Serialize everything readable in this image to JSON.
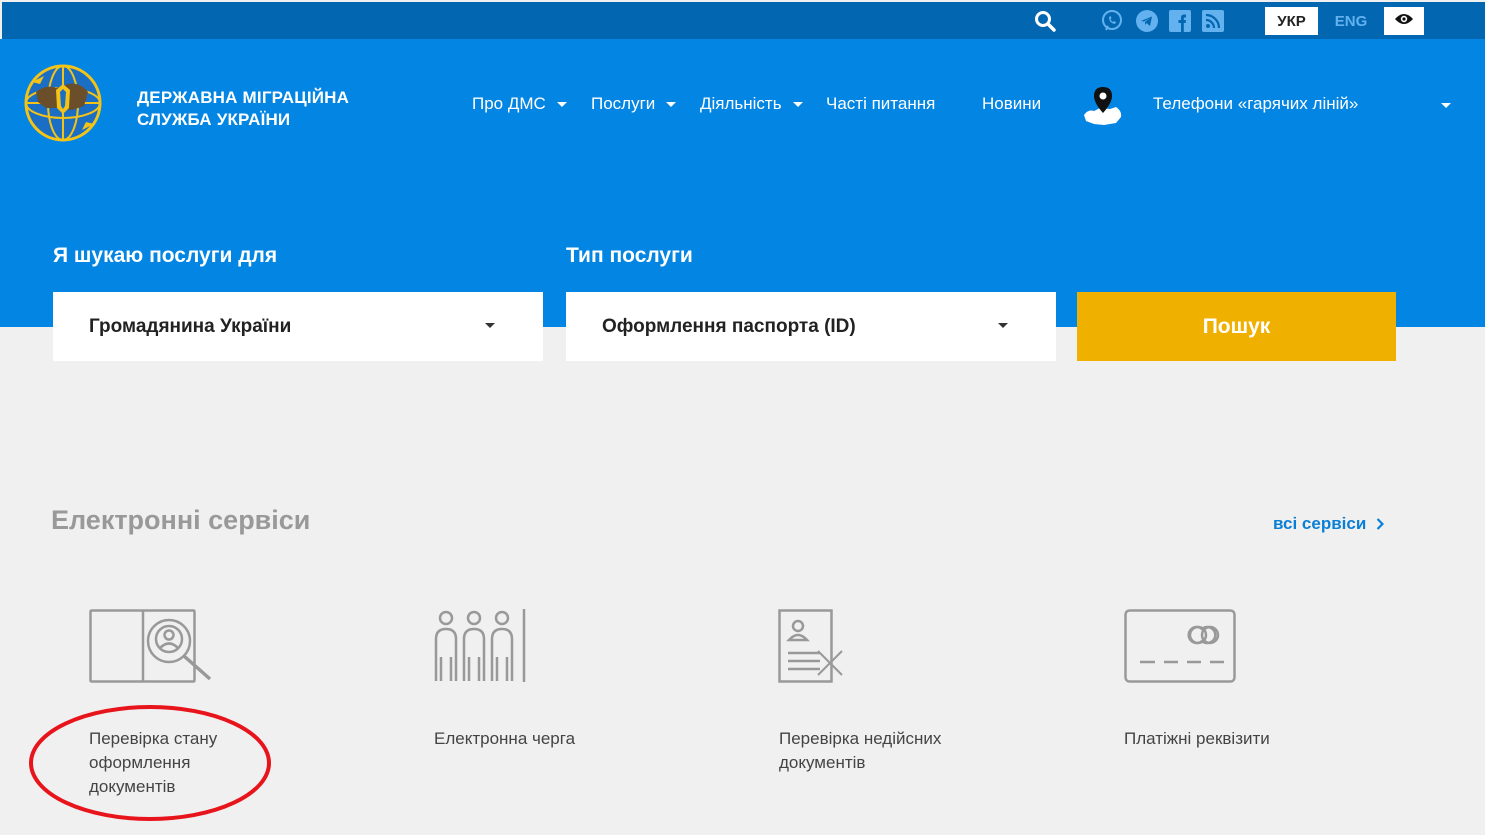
{
  "topbar": {
    "icons": [
      "search-icon",
      "viber-icon",
      "telegram-icon",
      "facebook-icon",
      "rss-icon",
      "eye-icon"
    ],
    "lang_ukr": "УКР",
    "lang_eng": "ENG"
  },
  "header": {
    "org_line1": "ДЕРЖАВНА МІГРАЦІЙНА",
    "org_line2": "СЛУЖБА УКРАЇНИ",
    "nav": [
      "Про ДМС",
      "Послуги",
      "Діяльність",
      "Часті питання",
      "Новини",
      "Телефони «гарячих ліній»"
    ]
  },
  "search": {
    "label_for": "Я шукаю послуги для",
    "label_type": "Тип послуги",
    "for_value": "Громадянина України",
    "type_value": "Оформлення паспорта (ID)",
    "button": "Пошук"
  },
  "services": {
    "title": "Електронні сервіси",
    "all_link": "всі сервіси",
    "items": [
      {
        "icon": "document-check-icon",
        "line1": "Перевірка стану",
        "line2": "оформлення",
        "line3": "документів"
      },
      {
        "icon": "queue-icon",
        "line1": "Електронна черга",
        "line2": "",
        "line3": ""
      },
      {
        "icon": "invalid-document-icon",
        "line1": "Перевірка недійсних",
        "line2": "документів",
        "line3": ""
      },
      {
        "icon": "card-icon",
        "line1": "Платіжні реквізити",
        "line2": "",
        "line3": ""
      }
    ]
  },
  "colors": {
    "topbar": "#0266b0",
    "hero": "#0385e3",
    "search_button": "#f0b000",
    "annotation": "#e8141b"
  }
}
